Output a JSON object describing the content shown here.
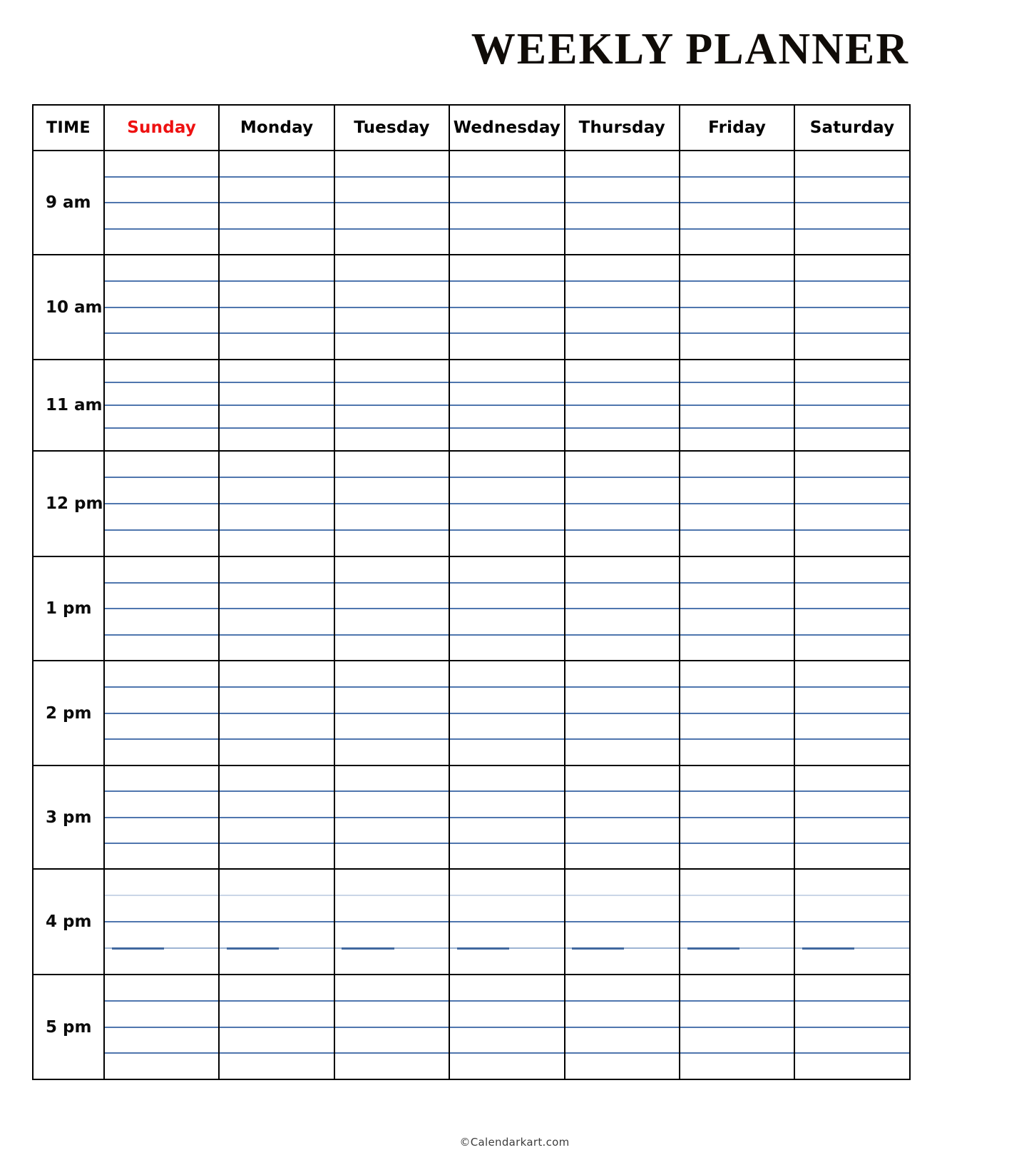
{
  "document": {
    "title": "WEEKLY PLANNER"
  },
  "table": {
    "columns": [
      {
        "key": "time",
        "label": "TIME",
        "color": "#000000"
      },
      {
        "key": "sunday",
        "label": "Sunday",
        "color": "#ee1111"
      },
      {
        "key": "monday",
        "label": "Monday",
        "color": "#000000"
      },
      {
        "key": "tuesday",
        "label": "Tuesday",
        "color": "#000000"
      },
      {
        "key": "wednesday",
        "label": "Wednesday",
        "color": "#000000"
      },
      {
        "key": "thursday",
        "label": "Thursday",
        "color": "#000000"
      },
      {
        "key": "friday",
        "label": "Friday",
        "color": "#000000"
      },
      {
        "key": "saturday",
        "label": "Saturday",
        "color": "#000000"
      }
    ],
    "rows": [
      {
        "time": "9 am",
        "entries": [
          "",
          "",
          "",
          "",
          "",
          "",
          ""
        ]
      },
      {
        "time": "10 am",
        "entries": [
          "",
          "",
          "",
          "",
          "",
          "",
          ""
        ]
      },
      {
        "time": "11 am",
        "entries": [
          "",
          "",
          "",
          "",
          "",
          "",
          ""
        ]
      },
      {
        "time": "12 pm",
        "entries": [
          "",
          "",
          "",
          "",
          "",
          "",
          ""
        ]
      },
      {
        "time": "1 pm",
        "entries": [
          "",
          "",
          "",
          "",
          "",
          "",
          ""
        ]
      },
      {
        "time": "2 pm",
        "entries": [
          "",
          "",
          "",
          "",
          "",
          "",
          ""
        ]
      },
      {
        "time": "3 pm",
        "entries": [
          "",
          "",
          "",
          "",
          "",
          "",
          ""
        ]
      },
      {
        "time": "4 pm",
        "entries": [
          "",
          "",
          "",
          "",
          "",
          "",
          ""
        ]
      },
      {
        "time": "5 pm",
        "entries": [
          "",
          "",
          "",
          "",
          "",
          "",
          ""
        ]
      }
    ],
    "ruled_lines_per_hour": 3,
    "grid_color": "#000000",
    "rule_color": "#4f76ae"
  },
  "footer": {
    "credit": "©Calendarkart.com"
  }
}
